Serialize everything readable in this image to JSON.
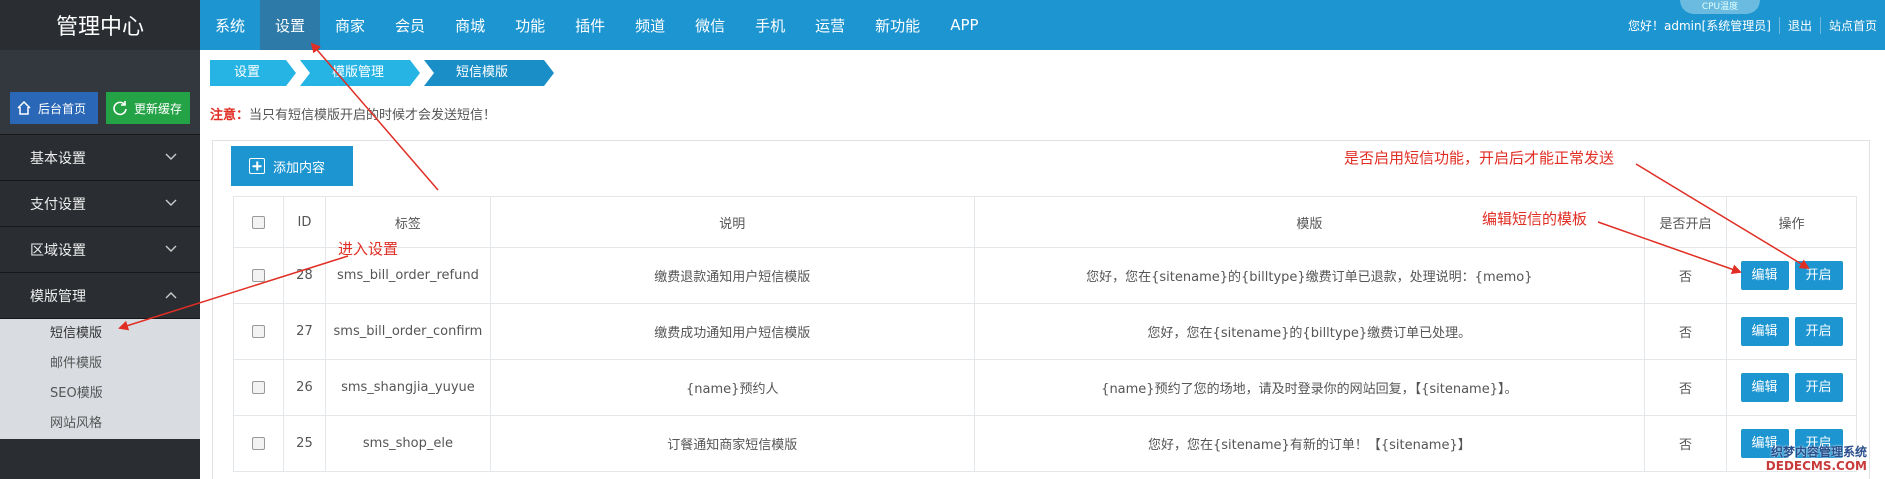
{
  "header": {
    "logo": "管理中心",
    "nav": [
      "系统",
      "设置",
      "商家",
      "会员",
      "商城",
      "功能",
      "插件",
      "频道",
      "微信",
      "手机",
      "运营",
      "新功能",
      "APP"
    ],
    "active_index": 1,
    "cpu_label": "CPU温度",
    "greeting": "您好！admin[系统管理员]",
    "logout": "退出",
    "site_home": "站点首页"
  },
  "sidebar": {
    "home_button": "后台首页",
    "cache_button": "更新缓存",
    "groups": [
      "基本设置",
      "支付设置",
      "区域设置",
      "模版管理"
    ],
    "submenu": [
      "短信模版",
      "邮件模版",
      "SEO模版",
      "网站风格"
    ]
  },
  "breadcrumb": [
    "设置",
    "模版管理",
    "短信模版"
  ],
  "notice": {
    "label": "注意：",
    "text": "当只有短信模版开启的时候才会发送短信！"
  },
  "toolbar": {
    "add_label": "添加内容"
  },
  "table": {
    "headers": [
      "",
      "ID",
      "标签",
      "说明",
      "模版",
      "是否开启",
      "操作"
    ],
    "edit_label": "编辑",
    "enable_label": "开启",
    "rows": [
      {
        "id": "28",
        "tag": "sms_bill_order_refund",
        "desc": "缴费退款通知用户短信模版",
        "template": "您好，您在{sitename}的{billtype}缴费订单已退款，处理说明：{memo}",
        "enabled": "否"
      },
      {
        "id": "27",
        "tag": "sms_bill_order_confirm",
        "desc": "缴费成功通知用户短信模版",
        "template": "您好，您在{sitename}的{billtype}缴费订单已处理。",
        "enabled": "否"
      },
      {
        "id": "26",
        "tag": "sms_shangjia_yuyue",
        "desc": "{name}预约人",
        "template": "{name}预约了您的场地，请及时登录你的网站回复，【{sitename}】。",
        "enabled": "否"
      },
      {
        "id": "25",
        "tag": "sms_shop_ele",
        "desc": "订餐通知商家短信模版",
        "template": "您好，您在{sitename}有新的订单！【{sitename}】",
        "enabled": "否"
      }
    ]
  },
  "annotations": {
    "enter_settings": "进入设置",
    "enable_function": "是否启用短信功能，开启后才能正常发送",
    "edit_template": "编辑短信的模板"
  },
  "watermark": {
    "line1": "织梦内容管理系统",
    "line2": "DEDECMS.COM"
  },
  "colors": {
    "primary": "#1c95d0",
    "sidebar": "#2a2e33",
    "annotation": "#e02e24",
    "breadcrumb": "#26b4e4"
  }
}
